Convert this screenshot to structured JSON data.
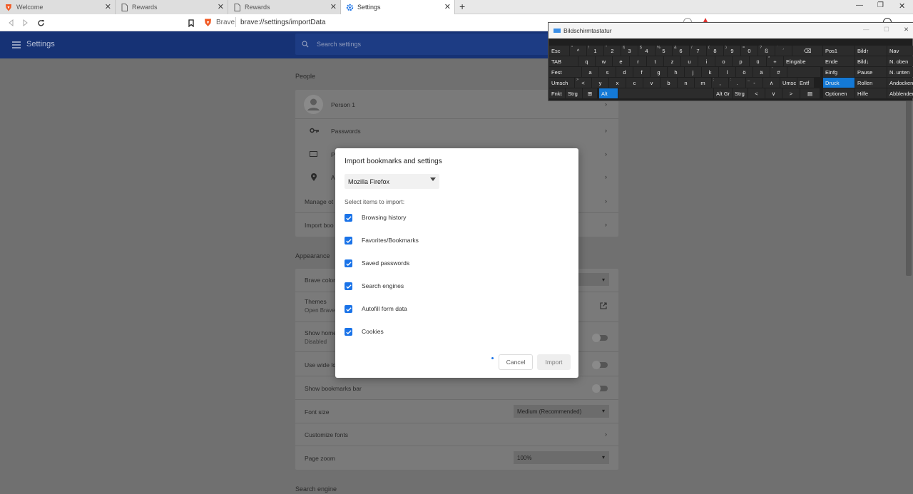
{
  "tabs": [
    {
      "label": "Welcome",
      "icon": "brave-lion-icon"
    },
    {
      "label": "Rewards",
      "icon": "page-icon"
    },
    {
      "label": "Rewards",
      "icon": "page-icon"
    },
    {
      "label": "Settings",
      "icon": "gear-icon"
    }
  ],
  "address": {
    "prefix": "Brave",
    "url": "brave://settings/importData"
  },
  "header": {
    "title": "Settings",
    "search_placeholder": "Search settings"
  },
  "people": {
    "title": "People",
    "person": "Person 1",
    "passwords": "Passwords",
    "payment_partial": "P",
    "addresses_partial": "A",
    "manage": "Manage ot",
    "import": "Import boo"
  },
  "appearance": {
    "title": "Appearance",
    "brave_colors": "Brave color",
    "themes": "Themes",
    "themes_sub": "Open Brave",
    "show_home": "Show home",
    "show_home_sub": "Disabled",
    "wide_location": "Use wide lo",
    "bookmarks_bar": "Show bookmarks bar",
    "font_size": "Font size",
    "font_size_value": "Medium (Recommended)",
    "customize_fonts": "Customize fonts",
    "page_zoom": "Page zoom",
    "page_zoom_value": "100%"
  },
  "search_engine": {
    "title": "Search engine"
  },
  "dialog": {
    "title": "Import bookmarks and settings",
    "browser": "Mozilla Firefox",
    "select_label": "Select items to import:",
    "items": [
      {
        "label": "Browsing history",
        "checked": true
      },
      {
        "label": "Favorites/Bookmarks",
        "checked": true
      },
      {
        "label": "Saved passwords",
        "checked": true
      },
      {
        "label": "Search engines",
        "checked": true
      },
      {
        "label": "Autofill form data",
        "checked": true
      },
      {
        "label": "Cookies",
        "checked": true
      }
    ],
    "cancel": "Cancel",
    "import": "Import"
  },
  "osk": {
    "title": "Bildschirmtastatur",
    "row1": [
      "Esc",
      "^",
      "1",
      "2",
      "3",
      "4",
      "5",
      "6",
      "7",
      "8",
      "9",
      "0",
      "ß",
      "´",
      "⌫"
    ],
    "row1_shift": [
      "",
      "°",
      "!",
      "\"",
      "§",
      "$",
      "%",
      "&",
      "/",
      "(",
      ")",
      "=",
      "?",
      "`",
      ""
    ],
    "row2": [
      "TAB",
      "q",
      "w",
      "e",
      "r",
      "t",
      "z",
      "u",
      "i",
      "o",
      "p",
      "ü",
      "+",
      "Eingabe"
    ],
    "row2_shift": [
      "",
      "",
      "",
      "",
      "",
      "",
      "",
      "",
      "",
      "",
      "",
      "",
      "*",
      ""
    ],
    "row3": [
      "Fest",
      "a",
      "s",
      "d",
      "f",
      "g",
      "h",
      "j",
      "k",
      "l",
      "ö",
      "ä",
      "#"
    ],
    "row3_shift": [
      "",
      "",
      "",
      "",
      "",
      "",
      "",
      "",
      "",
      "",
      "",
      "",
      "'"
    ],
    "row4": [
      "Umsch",
      "<",
      "y",
      "x",
      "c",
      "v",
      "b",
      "n",
      "m",
      ",",
      ".",
      "-",
      "∧",
      "Umsc",
      "Entf"
    ],
    "row4_shift": [
      "",
      ">",
      "",
      "",
      "",
      "",
      "",
      "",
      "",
      ";",
      ":",
      "_",
      "",
      "",
      ""
    ],
    "row5": [
      "Fnkt",
      "Strg",
      "⊞",
      "Alt",
      "",
      "Alt Gr",
      "Strg",
      "<",
      "∨",
      ">",
      "▤"
    ],
    "nav_col1": [
      "Pos1",
      "Ende",
      "Einfg",
      "Druck",
      "Optionen"
    ],
    "nav_col2": [
      "Bild↑",
      "Bild↓",
      "Pause",
      "Rollen",
      "Hilfe"
    ],
    "nav_col3": [
      "Nav",
      "N. oben",
      "N. unten",
      "Andocken",
      "Abblenden"
    ]
  },
  "colors": {
    "header_bg": "#163275",
    "accent": "#1a73e8",
    "osk_highlight": "#1479d6"
  }
}
